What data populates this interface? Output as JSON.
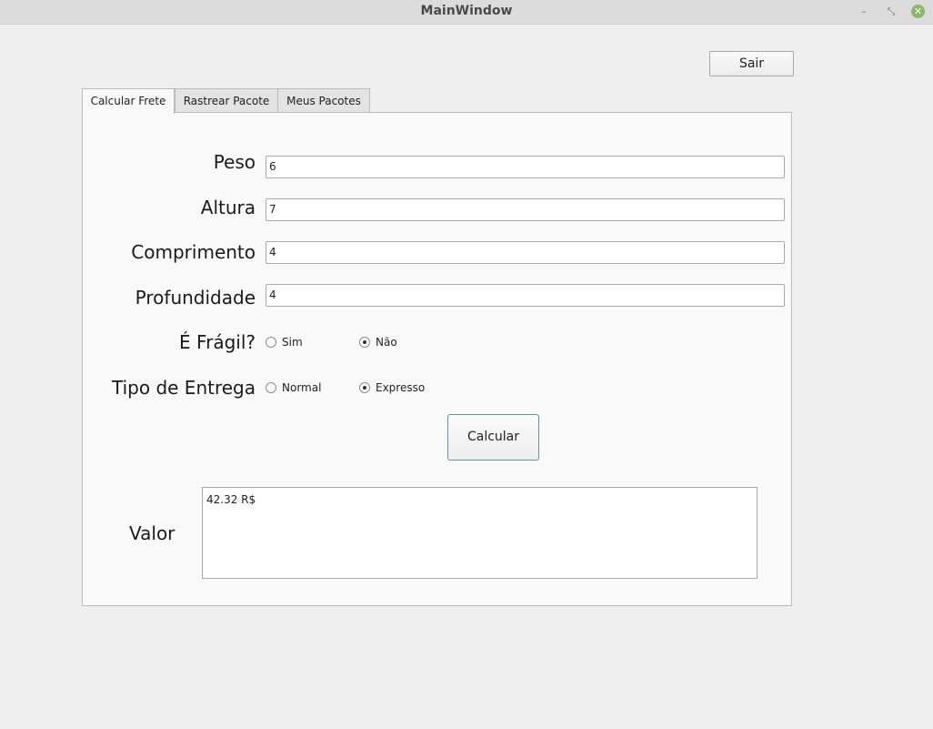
{
  "window": {
    "title": "MainWindow",
    "controls": {
      "minimize": "–",
      "maximize": "⤡",
      "close": "✕"
    }
  },
  "header": {
    "sair_label": "Sair"
  },
  "tabs": [
    {
      "label": "Calcular Frete",
      "active": true
    },
    {
      "label": "Rastrear Pacote",
      "active": false
    },
    {
      "label": "Meus Pacotes",
      "active": false
    }
  ],
  "form": {
    "peso": {
      "label": "Peso",
      "value": "6"
    },
    "altura": {
      "label": "Altura",
      "value": "7"
    },
    "comprimento": {
      "label": "Comprimento",
      "value": "4"
    },
    "profundidade": {
      "label": "Profundidade",
      "value": "4"
    },
    "fragil": {
      "label": "É Frágil?",
      "options": [
        {
          "label": "Sim",
          "checked": false
        },
        {
          "label": "Não",
          "checked": true
        }
      ]
    },
    "tipo_entrega": {
      "label": "Tipo de Entrega",
      "options": [
        {
          "label": "Normal",
          "checked": false
        },
        {
          "label": "Expresso",
          "checked": true
        }
      ]
    },
    "calcular_label": "Calcular"
  },
  "result": {
    "label": "Valor",
    "value": "42.32 R$"
  }
}
